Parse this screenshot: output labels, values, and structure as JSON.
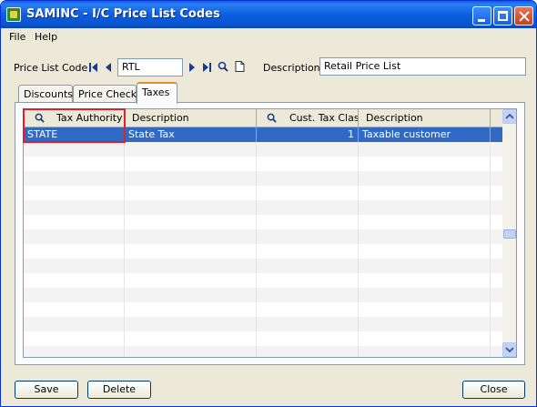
{
  "window": {
    "title": "SAMINC - I/C Price List Codes"
  },
  "menu": [
    {
      "label": "File"
    },
    {
      "label": "Help"
    }
  ],
  "header": {
    "price_list_code_label": "Price List Code",
    "price_list_code_value": "RTL",
    "description_label": "Description",
    "description_value": "Retail Price List"
  },
  "tabs": [
    {
      "label": "Discounts",
      "active": false
    },
    {
      "label": "Price Check",
      "active": false
    },
    {
      "label": "Taxes",
      "active": true
    }
  ],
  "grid": {
    "columns": [
      "Tax Authority",
      "Description",
      "Cust. Tax Class",
      "Description"
    ],
    "rows": [
      {
        "tax_authority": "STATE",
        "description": "State Tax",
        "cust_tax_class": "1",
        "class_description": "Taxable customer"
      }
    ]
  },
  "buttons": {
    "save": "Save",
    "delete": "Delete",
    "close": "Close"
  },
  "icons": {
    "first": "first-record-icon",
    "prev": "previous-record-icon",
    "next": "next-record-icon",
    "last": "last-record-icon",
    "lookup": "lookup-icon",
    "new": "new-document-icon"
  },
  "colors": {
    "title_bar": "#0a54d0",
    "selection": "#316ac5",
    "highlight_box": "#e0202a",
    "active_tab_accent": "#e68b2c"
  }
}
